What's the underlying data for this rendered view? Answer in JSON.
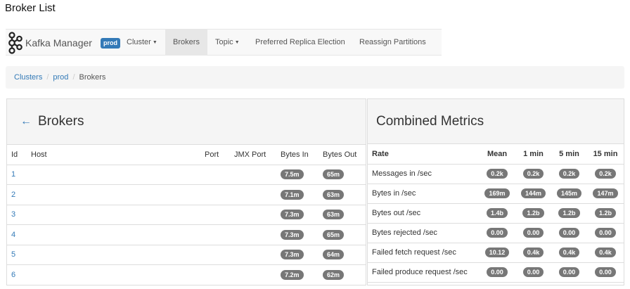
{
  "page_title": "Broker List",
  "navbar": {
    "brand": "Kafka Manager",
    "env_badge": "prod",
    "items": [
      {
        "label": "Cluster",
        "dropdown": true
      },
      {
        "label": "Brokers",
        "active": true
      },
      {
        "label": "Topic",
        "dropdown": true
      },
      {
        "label": "Preferred Replica Election"
      },
      {
        "label": "Reassign Partitions"
      }
    ]
  },
  "breadcrumb": [
    "Clusters",
    "prod",
    "Brokers"
  ],
  "brokers_panel": {
    "title": "Brokers",
    "columns": [
      "Id",
      "Host",
      "Port",
      "JMX Port",
      "Bytes In",
      "Bytes Out"
    ],
    "rows": [
      {
        "id": "1",
        "host": "",
        "port": "",
        "jmx": "",
        "bytes_in": "7.5m",
        "bytes_out": "65m"
      },
      {
        "id": "2",
        "host": "",
        "port": "",
        "jmx": "",
        "bytes_in": "7.1m",
        "bytes_out": "63m"
      },
      {
        "id": "3",
        "host": "",
        "port": "",
        "jmx": "",
        "bytes_in": "7.3m",
        "bytes_out": "63m"
      },
      {
        "id": "4",
        "host": "",
        "port": "",
        "jmx": "",
        "bytes_in": "7.3m",
        "bytes_out": "65m"
      },
      {
        "id": "5",
        "host": "",
        "port": "",
        "jmx": "",
        "bytes_in": "7.3m",
        "bytes_out": "64m"
      },
      {
        "id": "6",
        "host": "",
        "port": "",
        "jmx": "",
        "bytes_in": "7.2m",
        "bytes_out": "62m"
      }
    ]
  },
  "metrics_panel": {
    "title": "Combined Metrics",
    "columns": [
      "Rate",
      "Mean",
      "1 min",
      "5 min",
      "15 min"
    ],
    "rows": [
      {
        "rate": "Messages in /sec",
        "mean": "0.2k",
        "m1": "0.2k",
        "m5": "0.2k",
        "m15": "0.2k"
      },
      {
        "rate": "Bytes in /sec",
        "mean": "169m",
        "m1": "144m",
        "m5": "145m",
        "m15": "147m"
      },
      {
        "rate": "Bytes out /sec",
        "mean": "1.4b",
        "m1": "1.2b",
        "m5": "1.2b",
        "m15": "1.2b"
      },
      {
        "rate": "Bytes rejected /sec",
        "mean": "0.00",
        "m1": "0.00",
        "m5": "0.00",
        "m15": "0.00"
      },
      {
        "rate": "Failed fetch request /sec",
        "mean": "10.12",
        "m1": "0.4k",
        "m5": "0.4k",
        "m15": "0.4k"
      },
      {
        "rate": "Failed produce request /sec",
        "mean": "0.00",
        "m1": "0.00",
        "m5": "0.00",
        "m15": "0.00"
      }
    ]
  },
  "colors": {
    "link": "#337ab7",
    "badge": "#777777",
    "navbar_bg": "#f8f8f8",
    "active_nav_bg": "#e7e7e7"
  }
}
